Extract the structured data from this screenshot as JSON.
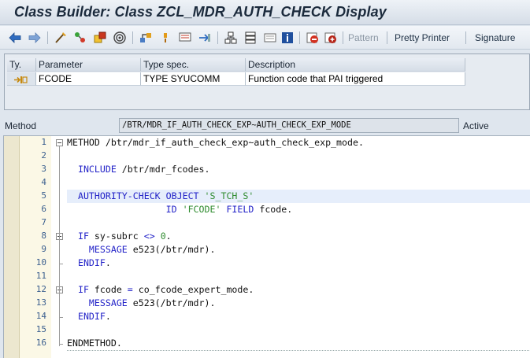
{
  "window": {
    "title": "Class Builder: Class ZCL_MDR_AUTH_CHECK Display"
  },
  "toolbar": {
    "icons": [
      "back-arrow-icon",
      "forward-arrow-icon",
      "other-object-icon",
      "display-change-icon",
      "active-inactive-icon",
      "check-icon",
      "activate-icon",
      "where-used-icon",
      "object-list-icon",
      "display-object-list-icon",
      "navigation-window-icon",
      "enhance-icon",
      "hierarchy-icon",
      "split-screen-icon",
      "info-icon",
      "breakpoint-icon",
      "external-breakpoint-icon"
    ],
    "pattern_label": "Pattern",
    "pretty_printer_label": "Pretty Printer",
    "signature_label": "Signature"
  },
  "parameters": {
    "headers": {
      "type": "Ty.",
      "parameter": "Parameter",
      "type_spec": "Type spec.",
      "description": "Description"
    },
    "rows": [
      {
        "type_icon": "importing-parameter-icon",
        "parameter": "FCODE",
        "type_spec": "TYPE SYUCOMM",
        "description": "Function code that PAI triggered"
      }
    ]
  },
  "method": {
    "label": "Method",
    "name": "/BTR/MDR_IF_AUTH_CHECK_EXP~AUTH_CHECK_EXP_MODE",
    "status": "Active"
  },
  "editor": {
    "lines": [
      {
        "num": "1",
        "tokens": [
          {
            "t": "METHOD",
            "c": "plain"
          },
          {
            "t": " /btr/mdr_if_auth_check_exp~auth_check_exp_mode.",
            "c": "plain"
          }
        ]
      },
      {
        "num": "2",
        "tokens": []
      },
      {
        "num": "3",
        "tokens": [
          {
            "t": "  INCLUDE",
            "c": "kw"
          },
          {
            "t": " /btr/mdr_fcodes.",
            "c": "plain"
          }
        ]
      },
      {
        "num": "4",
        "tokens": []
      },
      {
        "num": "5",
        "tokens": [
          {
            "t": "  AUTHORITY-CHECK",
            "c": "kw"
          },
          {
            "t": " ",
            "c": "plain"
          },
          {
            "t": "OBJECT",
            "c": "kw"
          },
          {
            "t": " ",
            "c": "plain"
          },
          {
            "t": "'S_TCH_S'",
            "c": "str"
          }
        ]
      },
      {
        "num": "6",
        "tokens": [
          {
            "t": "                  ID",
            "c": "kw"
          },
          {
            "t": " ",
            "c": "plain"
          },
          {
            "t": "'FCODE'",
            "c": "str"
          },
          {
            "t": " ",
            "c": "plain"
          },
          {
            "t": "FIELD",
            "c": "kw"
          },
          {
            "t": " fcode.",
            "c": "plain"
          }
        ]
      },
      {
        "num": "7",
        "tokens": []
      },
      {
        "num": "8",
        "tokens": [
          {
            "t": "  IF",
            "c": "kw"
          },
          {
            "t": " sy-subrc ",
            "c": "plain"
          },
          {
            "t": "<>",
            "c": "kw"
          },
          {
            "t": " ",
            "c": "plain"
          },
          {
            "t": "0",
            "c": "num"
          },
          {
            "t": ".",
            "c": "plain"
          }
        ]
      },
      {
        "num": "9",
        "tokens": [
          {
            "t": "    MESSAGE",
            "c": "kw"
          },
          {
            "t": " e523(/btr/mdr).",
            "c": "plain"
          }
        ]
      },
      {
        "num": "10",
        "tokens": [
          {
            "t": "  ENDIF",
            "c": "kw"
          },
          {
            "t": ".",
            "c": "plain"
          }
        ]
      },
      {
        "num": "11",
        "tokens": []
      },
      {
        "num": "12",
        "tokens": [
          {
            "t": "  IF",
            "c": "kw"
          },
          {
            "t": " fcode ",
            "c": "plain"
          },
          {
            "t": "=",
            "c": "kw"
          },
          {
            "t": " co_fcode_expert_mode.",
            "c": "plain"
          }
        ]
      },
      {
        "num": "13",
        "tokens": [
          {
            "t": "    MESSAGE",
            "c": "kw"
          },
          {
            "t": " e523(/btr/mdr).",
            "c": "plain"
          }
        ]
      },
      {
        "num": "14",
        "tokens": [
          {
            "t": "  ENDIF",
            "c": "kw"
          },
          {
            "t": ".",
            "c": "plain"
          }
        ]
      },
      {
        "num": "15",
        "tokens": []
      },
      {
        "num": "16",
        "tokens": [
          {
            "t": "ENDMETHOD",
            "c": "plain"
          },
          {
            "t": ".",
            "c": "plain"
          }
        ]
      }
    ],
    "highlighted_line": "5"
  }
}
